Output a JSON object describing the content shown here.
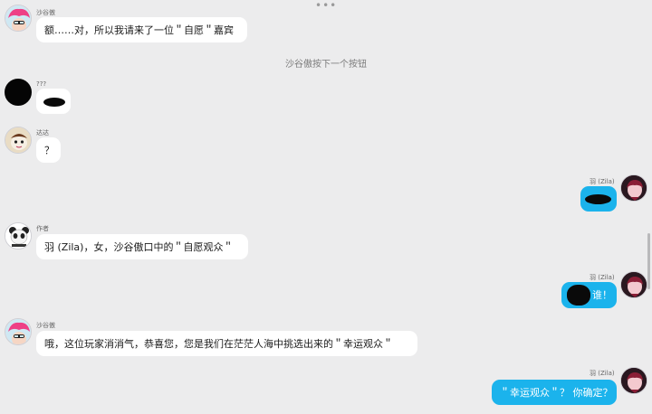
{
  "icons": {
    "more": "more-dots-icon",
    "scroll": "scrollbar-thumb"
  },
  "system_message": "沙谷傲按下一个按钮",
  "messages": [
    {
      "side": "left",
      "sender": "沙谷傲",
      "text": "额……对，所以我请来了一位＂自愿＂嘉宾",
      "avatar": "pink-hair-avatar"
    },
    {
      "side": "left",
      "sender": "???",
      "text": "",
      "avatar": "black-avatar"
    },
    {
      "side": "left",
      "sender": "达达",
      "text": "？",
      "avatar": "cartoon-avatar"
    },
    {
      "side": "right",
      "sender": "羽 (Zila)",
      "text": "",
      "avatar": "zila-avatar"
    },
    {
      "side": "left",
      "sender": "作者",
      "text": "羽 (Zila)，女，沙谷傲口中的＂自愿观众＂",
      "avatar": "panda-avatar"
    },
    {
      "side": "right",
      "sender": "羽 (Zila)",
      "text": "谁！",
      "avatar": "zila-avatar"
    },
    {
      "side": "left",
      "sender": "沙谷傲",
      "text": "哦，这位玩家消消气，恭喜您，您是我们在茫茫人海中挑选出来的＂幸运观众＂",
      "avatar": "pink-hair-avatar"
    },
    {
      "side": "right",
      "sender": "羽 (Zila)",
      "text": "＂幸运观众＂？ 你确定？",
      "avatar": "zila-avatar"
    }
  ],
  "colors": {
    "background": "#ececed",
    "bubble_left": "#ffffff",
    "bubble_right": "#1bb3ec"
  }
}
